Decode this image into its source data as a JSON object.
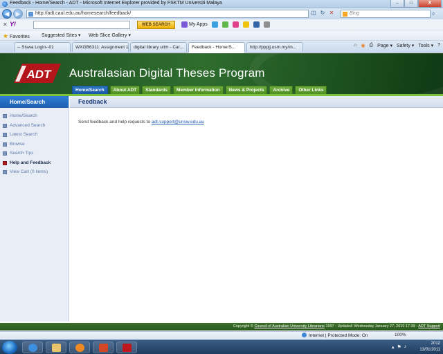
{
  "window": {
    "title": "Feedback - Home/Search - ADT - Microsoft Internet Explorer provided by FSKTM Universiti Malaya",
    "minimize": "–",
    "maximize": "□",
    "close": "X"
  },
  "address_bar": {
    "url": "http://adt.caul.edu.au/homesearch/feedback/",
    "back": "◀",
    "forward": "▶",
    "search_placeholder": "Bing"
  },
  "yahoo_toolbar": {
    "logo": "Y!",
    "web_search_label": "WEB SEARCH",
    "my_apps": "My Apps"
  },
  "favorites_bar": {
    "favorites": "Favorites",
    "suggested_sites": "Suggested Sites ▾",
    "web_slice_gallery": "Web Slice Gallery ▾"
  },
  "tabs": [
    {
      "label": "-- Siswa Login--01"
    },
    {
      "label": "WXGB6311: Assignment 1"
    },
    {
      "label": "digital library uitm - Car..."
    },
    {
      "label": "Feedback - Home/S..."
    },
    {
      "label": "http://pppjj.usm.my/m..."
    }
  ],
  "tab_tools": {
    "page": "Page ▾",
    "safety": "Safety ▾",
    "tools": "Tools ▾",
    "help": "?"
  },
  "site": {
    "logo_text": "ADT",
    "title": "Australasian Digital Theses Program",
    "nav": [
      {
        "label": "Home/Search"
      },
      {
        "label": "About ADT"
      },
      {
        "label": "Standards"
      },
      {
        "label": "Member Information"
      },
      {
        "label": "News & Projects"
      },
      {
        "label": "Archive"
      },
      {
        "label": "Other Links"
      }
    ]
  },
  "sidebar": {
    "heading": "Home/Search",
    "items": [
      {
        "label": "Home/Search"
      },
      {
        "label": "Advanced Search"
      },
      {
        "label": "Latest Search"
      },
      {
        "label": "Browse"
      },
      {
        "label": "Search Tips"
      },
      {
        "label": "Help and Feedback"
      },
      {
        "label": "View Cart (0 items)"
      }
    ]
  },
  "main": {
    "heading": "Feedback",
    "text": "Send feedback and help requests to ",
    "email": "adt-support@unsw.edu.au"
  },
  "footer": {
    "prefix": "Copyright © ",
    "org_link": "Council of Australian University Librarians",
    "middle": " 1997 - Updated: Wednesday January 27, 2010 17:39 - ",
    "support_link": "ADT Support"
  },
  "status_bar": {
    "zone": "Internet | Protected Mode: On",
    "zoom": "100%"
  },
  "taskbar": {
    "time": "2012",
    "date": "13/01/2011"
  }
}
